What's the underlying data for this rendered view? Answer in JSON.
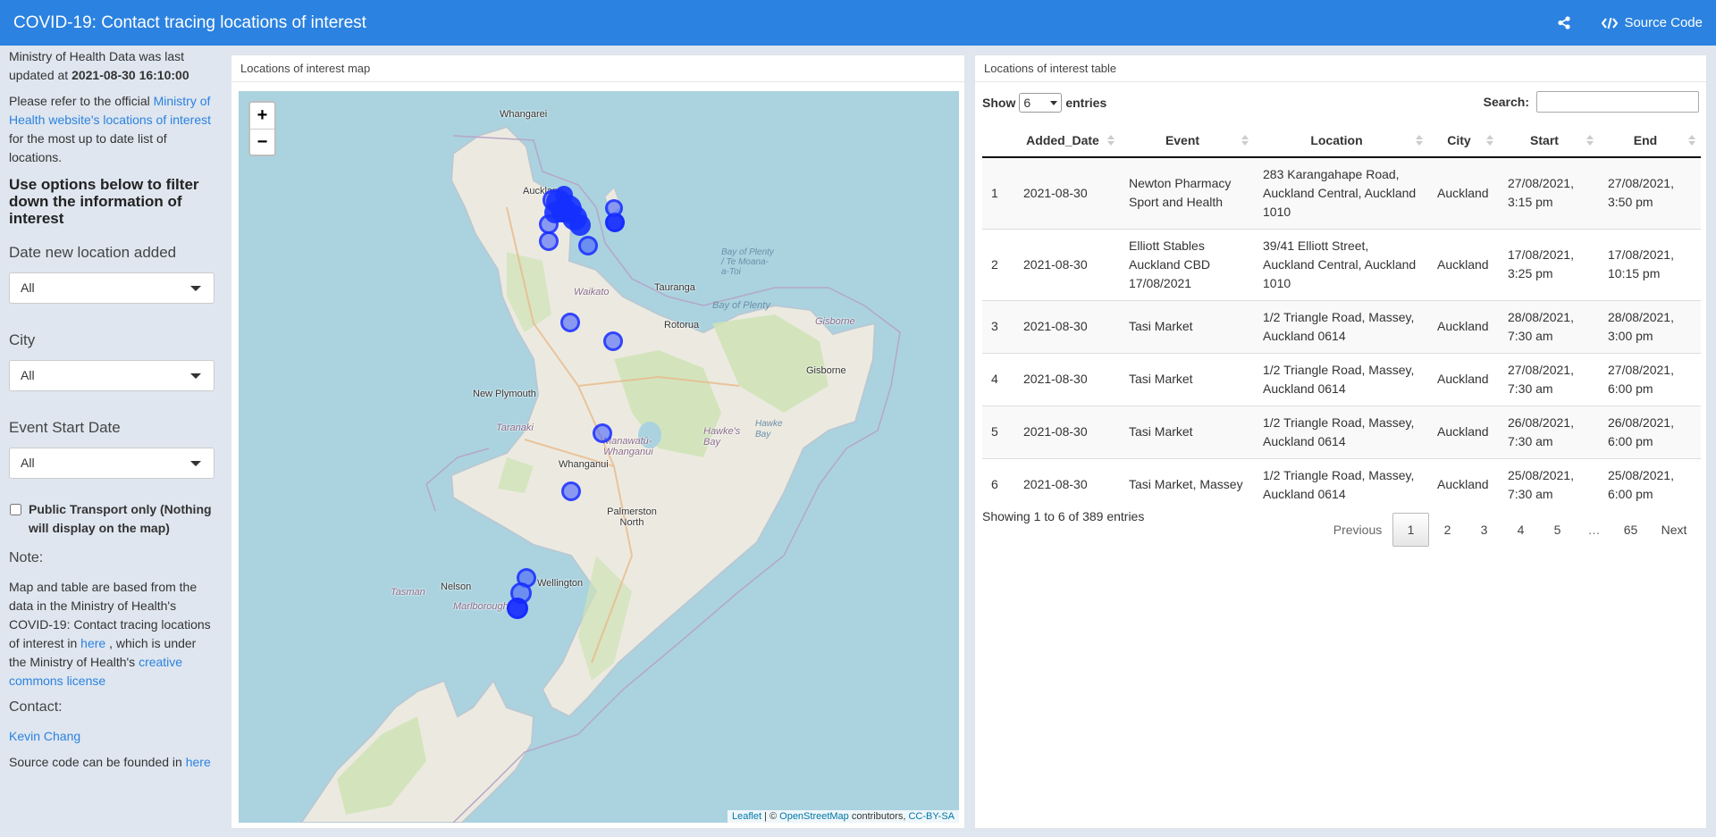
{
  "navbar": {
    "title": "COVID-19: Contact tracing locations of interest",
    "share_icon": "share-icon",
    "source_label": "Source Code",
    "source_icon": "code-icon"
  },
  "sidebar": {
    "updated_prefix": "Ministry of Health Data was last updated at ",
    "updated_value": "2021-08-30 16:10:00",
    "refer_prefix": "Please refer to the official ",
    "refer_link": "Ministry of Health website's locations of interest",
    "refer_suffix": " for the most up to date list of locations.",
    "filter_heading": "Use options below to filter down the information of interest",
    "date_label": "Date new location added",
    "date_value": "All",
    "city_label": "City",
    "city_value": "All",
    "start_label": "Event Start Date",
    "start_value": "All",
    "public_transport_label": "Public Transport only (Nothing will display on the map)",
    "public_transport_checked": false,
    "note_label": "Note:",
    "note_text_1": "Map and table are based from the data in the Ministry of Health's COVID-19: Contact tracing locations of interest in ",
    "note_link_here": "here",
    "note_text_2": " , which is under the Ministry of Health's ",
    "note_link_license": "creative commons license",
    "contact_label": "Contact:",
    "contact_name": "Kevin Chang",
    "source_text": "Source code can be founded in ",
    "source_link": "here"
  },
  "map_panel": {
    "title": "Locations of interest map",
    "zoom_in": "+",
    "zoom_out": "−",
    "attribution_leaflet": "Leaflet",
    "attribution_mid": " | © ",
    "attribution_osm": "OpenStreetMap",
    "attribution_contrib": " contributors, ",
    "attribution_cc": "CC-BY-SA",
    "places": {
      "whangarei": "Whangarei",
      "auckland": "Auckland",
      "waikato": "Waikato",
      "tauranga": "Tauranga",
      "bay_of_plenty": "Bay of Plenty",
      "bay_of_plenty_maori": "Bay of Plenty / Te Moana-a-Toi",
      "rotorua": "Rotorua",
      "gisborne_region": "Gisborne",
      "gisborne": "Gisborne",
      "new_plymouth": "New Plymouth",
      "taranaki": "Taranaki",
      "manawatu": "Manawatū-Whanganui",
      "hawkes_bay_region": "Hawke's Bay",
      "hawke_bay": "Hawke Bay",
      "whanganui": "Whanganui",
      "palmerston_north": "Palmerston North",
      "tasman": "Tasman",
      "nelson": "Nelson",
      "marlborough": "Marlborough",
      "wellington": "Wellington"
    }
  },
  "table_panel": {
    "title": "Locations of interest table",
    "show_label": "Show",
    "entries_value": "6",
    "entries_label": "entries",
    "search_label": "Search:",
    "search_value": "",
    "columns": [
      "",
      "Added_Date",
      "Event",
      "Location",
      "City",
      "Start",
      "End"
    ],
    "rows": [
      {
        "n": "1",
        "added": "2021-08-30",
        "event": "Newton Pharmacy Sport and Health",
        "location": "283 Karangahape Road, Auckland Central, Auckland 1010",
        "city": "Auckland",
        "start": "27/08/2021, 3:15 pm",
        "end": "27/08/2021, 3:50 pm"
      },
      {
        "n": "2",
        "added": "2021-08-30",
        "event": "Elliott Stables Auckland CBD 17/08/2021",
        "location": "39/41 Elliott Street, Auckland Central, Auckland 1010",
        "city": "Auckland",
        "start": "17/08/2021, 3:25 pm",
        "end": "17/08/2021, 10:15 pm"
      },
      {
        "n": "3",
        "added": "2021-08-30",
        "event": "Tasi Market",
        "location": "1/2 Triangle Road, Massey, Auckland 0614",
        "city": "Auckland",
        "start": "28/08/2021, 7:30 am",
        "end": "28/08/2021, 3:00 pm"
      },
      {
        "n": "4",
        "added": "2021-08-30",
        "event": "Tasi Market",
        "location": "1/2 Triangle Road, Massey, Auckland 0614",
        "city": "Auckland",
        "start": "27/08/2021, 7:30 am",
        "end": "27/08/2021, 6:00 pm"
      },
      {
        "n": "5",
        "added": "2021-08-30",
        "event": "Tasi Market",
        "location": "1/2 Triangle Road, Massey, Auckland 0614",
        "city": "Auckland",
        "start": "26/08/2021, 7:30 am",
        "end": "26/08/2021, 6:00 pm"
      },
      {
        "n": "6",
        "added": "2021-08-30",
        "event": "Tasi Market, Massey",
        "location": "1/2 Triangle Road, Massey, Auckland 0614",
        "city": "Auckland",
        "start": "25/08/2021, 7:30 am",
        "end": "25/08/2021, 6:00 pm"
      }
    ],
    "info": "Showing 1 to 6 of 389 entries",
    "pagination": {
      "previous": "Previous",
      "pages": [
        "1",
        "2",
        "3",
        "4",
        "5",
        "…",
        "65"
      ],
      "active": "1",
      "next": "Next"
    }
  }
}
